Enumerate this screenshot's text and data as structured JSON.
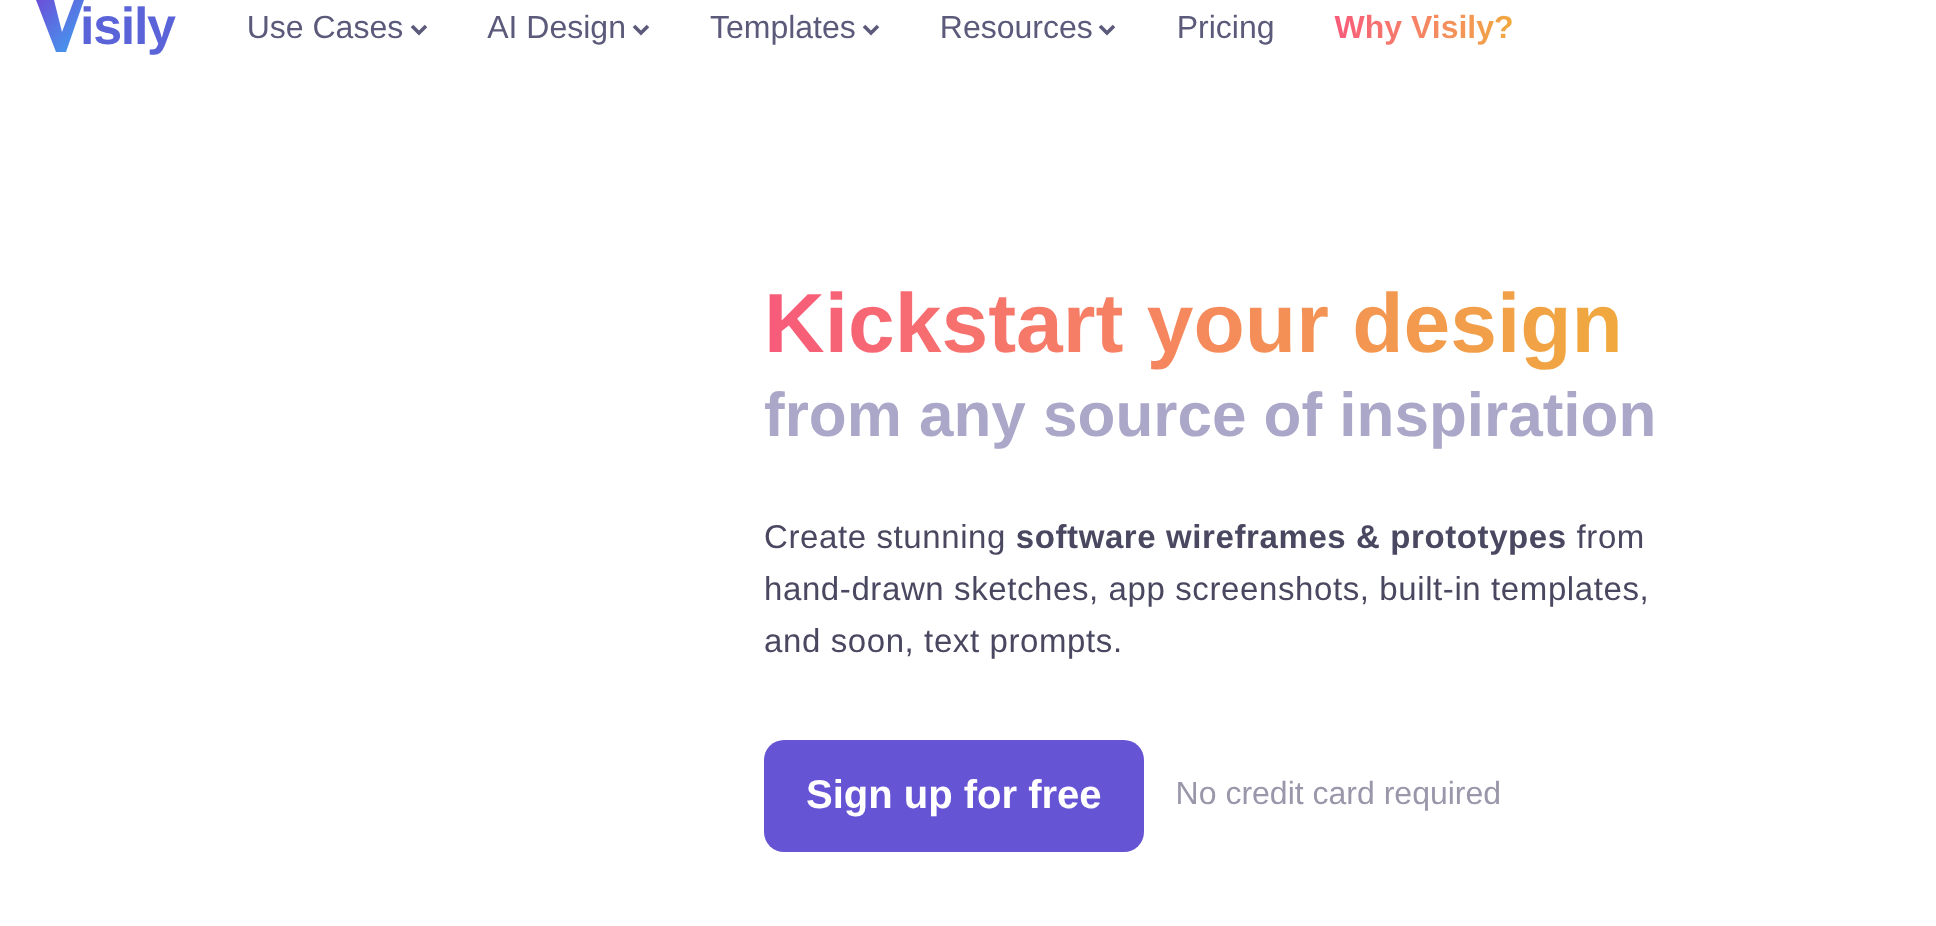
{
  "logo": {
    "text": "isily"
  },
  "nav": [
    {
      "label": "Use Cases",
      "dropdown": true,
      "highlight": false
    },
    {
      "label": "AI Design",
      "dropdown": true,
      "highlight": false
    },
    {
      "label": "Templates",
      "dropdown": true,
      "highlight": false
    },
    {
      "label": "Resources",
      "dropdown": true,
      "highlight": false
    },
    {
      "label": "Pricing",
      "dropdown": false,
      "highlight": false
    },
    {
      "label": "Why Visily?",
      "dropdown": false,
      "highlight": true
    }
  ],
  "hero": {
    "title": "Kickstart your design",
    "subtitle": "from any source of inspiration",
    "description": "Create stunning **software wireframes & prototypes** from hand-drawn sketches, app screenshots, built-in templates, and soon, text prompts.",
    "cta": "Sign up for free",
    "note": "No credit card required"
  }
}
